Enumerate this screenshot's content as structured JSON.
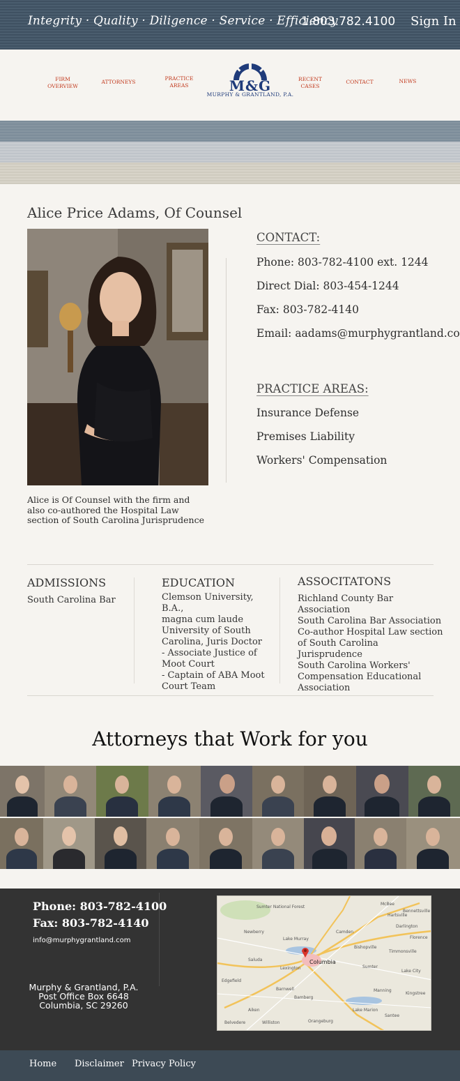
{
  "header": {
    "slogan": "Integrity · Quality · Diligence · Service · Efficiency",
    "phone": "1.803.782.4100",
    "sign_in": "Sign In"
  },
  "nav": {
    "firm_overview": [
      "FIRM",
      "OVERVIEW"
    ],
    "attorneys": "ATTORNEYS",
    "practice_areas": [
      "PRACTICE",
      "AREAS"
    ],
    "recent_cases": [
      "RECENT",
      "CASES"
    ],
    "contact": "CONTACT",
    "news": "NEWS"
  },
  "logo": {
    "initials": "M&G",
    "firm_name": "MURPHY & GRANTLAND, P.A."
  },
  "profile": {
    "title": "Alice Price Adams, Of Counsel",
    "bio": "Alice is Of Counsel with the firm and also co-authored the Hospital Law section of South Carolina Jurisprudence"
  },
  "contact": {
    "heading": "CONTACT:",
    "phone": "Phone: 803-782-4100 ext. 1244",
    "direct": "Direct Dial: 803-454-1244",
    "fax": "Fax: 803-782-4140",
    "email": "Email: aadams@murphygrantland.com"
  },
  "practice": {
    "heading": "PRACTICE AREAS:",
    "items": [
      "Insurance Defense",
      "Premises Liability",
      "Workers' Compensation"
    ]
  },
  "admissions": {
    "heading": "ADMISSIONS",
    "body": "South Carolina Bar"
  },
  "education": {
    "heading": "EDUCATION",
    "lines": [
      "Clemson University, B.A.,",
      "magna cum laude",
      "University of South",
      "Carolina, Juris Doctor",
      "- Associate Justice of",
      "Moot Court",
      "- Captain of ABA Moot",
      "Court Team"
    ]
  },
  "associations": {
    "heading": "ASSOCITATONS",
    "lines": [
      "Richland County Bar Association",
      "South Carolina Bar Association",
      "Co-author Hospital Law section",
      "of South Carolina Jurisprudence",
      "South Carolina Workers'",
      "Compensation Educational",
      "Association"
    ]
  },
  "attorneys": {
    "title": "Attorneys that Work for you"
  },
  "footer": {
    "phone": "Phone:  803-782-4100",
    "fax": "Fax:  803-782-4140",
    "email": "info@murphygrantland.com",
    "address": [
      "Murphy & Grantland, P.A.",
      "Post Office Box 6648",
      "Columbia, SC 29260"
    ],
    "map_labels": [
      "Sumter National Forest",
      "Columbia",
      "Sumter",
      "Camden",
      "Darlington",
      "Florence",
      "Newberry",
      "Lake Murray",
      "Aiken",
      "Orangeburg",
      "Manning",
      "Kingstree",
      "Lake Marion",
      "Saluda",
      "Bishopville",
      "Lexington",
      "Edgefield",
      "Barnwell",
      "Williston",
      "Bamberg",
      "Belvedere",
      "McBee",
      "Hartsville",
      "Timmonsville",
      "Lake City",
      "Santee",
      "Bennettsville"
    ]
  },
  "bottom_links": {
    "home": "Home",
    "disclaimer": "Disclaimer",
    "privacy": "Privacy Policy"
  }
}
